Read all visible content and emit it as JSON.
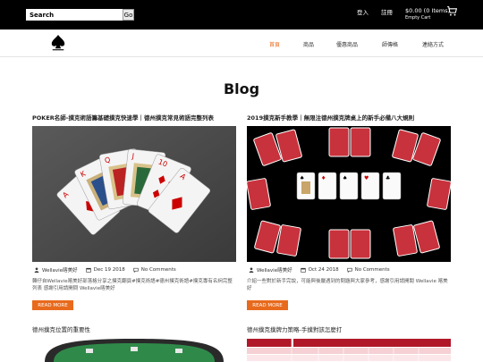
{
  "topbar": {
    "search_placeholder": "Search",
    "search_button": "Go",
    "login": "登入",
    "register": "註冊",
    "cart_amount": "$0.00 (0 Items)",
    "cart_empty": "Empty Cart"
  },
  "nav": {
    "items": [
      {
        "label": "首頁",
        "active": true
      },
      {
        "label": "商品",
        "active": false
      },
      {
        "label": "優惠商品",
        "active": false
      },
      {
        "label": "師傳格",
        "active": false
      },
      {
        "label": "連絡方式",
        "active": false
      }
    ]
  },
  "page": {
    "title": "Blog"
  },
  "posts": [
    {
      "title": "POKER名師-撲克術語籌基礎撲克快速學｜德州撲克常見術語完整列表",
      "author": "Wellavie喀美好",
      "date": "Dec 19 2018",
      "comments": "No Comments",
      "excerpt": "轉仔自Wellavie喀美好部落格分享之撲克翻頁#撲克術語#德州撲克術語#撲克專有名詞完整列表 感謝引用請開問 Wellavie喀美好",
      "read_more": "READ MORE"
    },
    {
      "title": "2019撲克新手教學｜無限注德州撲克牌桌上的新手必備八大規則",
      "author": "Wellavie喀美好",
      "date": "Oct 24 2018",
      "comments": "No Comments",
      "excerpt": "介紹一些對於新手完說，可能與後嚴遇到的問題與大家參考，感謝引用請開閱 Wellavie 喀美好",
      "read_more": "READ MORE"
    },
    {
      "title": "德州撲克位置的重要性"
    },
    {
      "title": "德州撲克撲牌力策略-手撲對該怎麼打"
    }
  ],
  "colors": {
    "accent": "#e86a1c",
    "topbar": "#000000"
  }
}
